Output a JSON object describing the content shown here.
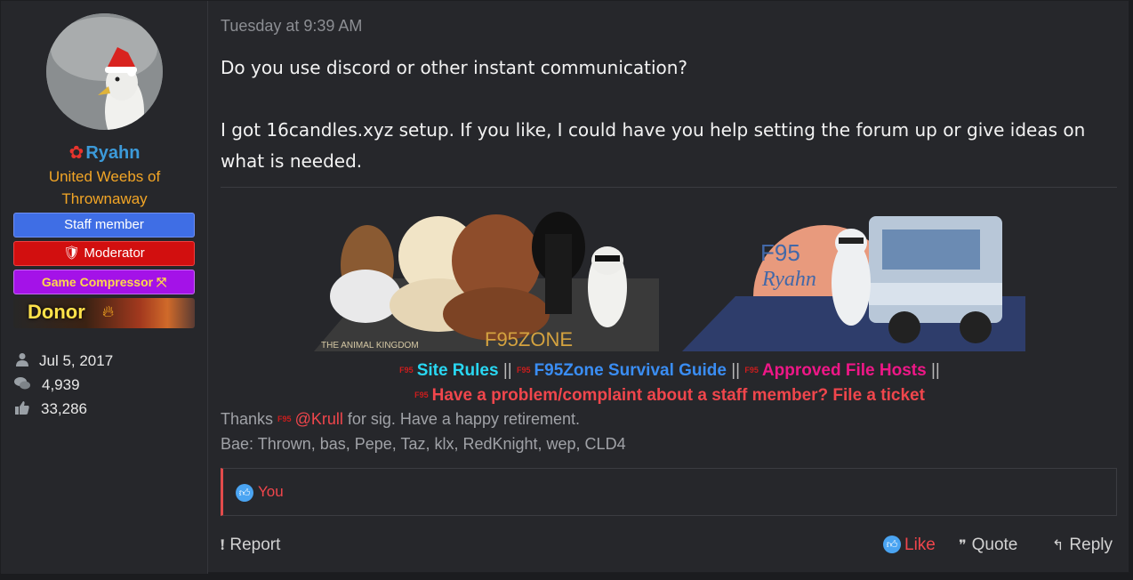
{
  "user": {
    "name": "Ryahn",
    "title": "United Weebs of Thrownaway",
    "banners": {
      "staff": "Staff member",
      "moderator": "Moderator",
      "game_compressor": "Game Compressor",
      "donor": "Donor"
    },
    "stats": {
      "joined": "Jul 5, 2017",
      "messages": "4,939",
      "reactions": "33,286"
    }
  },
  "post": {
    "date": "Tuesday at 9:39 AM",
    "line1": "Do you use discord or other instant communication?",
    "line2": "I got 16candles.xyz setup. If you like, I could have you help setting the forum up or give ideas on what is needed."
  },
  "signature": {
    "left_banner": {
      "caption": "THE ANIMAL KINGDOM",
      "brand": "F95ZONE"
    },
    "right_banner": {
      "brand": "F95",
      "name": "Ryahn"
    },
    "mini_logo": "F95",
    "links": {
      "site_rules": "Site Rules",
      "survival_guide": "F95Zone Survival Guide",
      "file_hosts": "Approved File Hosts",
      "ticket": "Have a problem/complaint about a staff member? File a ticket",
      "separator": "||"
    },
    "thanks_prefix": "Thanks",
    "thanks_mention": "@Krull",
    "thanks_suffix": "for sig. Have a happy retirement.",
    "bae": "Bae: Thrown, bas, Pepe, Taz, klx, RedKnight, wep, CLD4"
  },
  "reactions": {
    "text": "You"
  },
  "actions": {
    "report": "Report",
    "like": "Like",
    "quote": "Quote",
    "reply": "Reply"
  },
  "colors": {
    "background": "#26272b",
    "username": "#3c9ad9",
    "user_title": "#f2a526",
    "accent_red": "#f0464c"
  }
}
